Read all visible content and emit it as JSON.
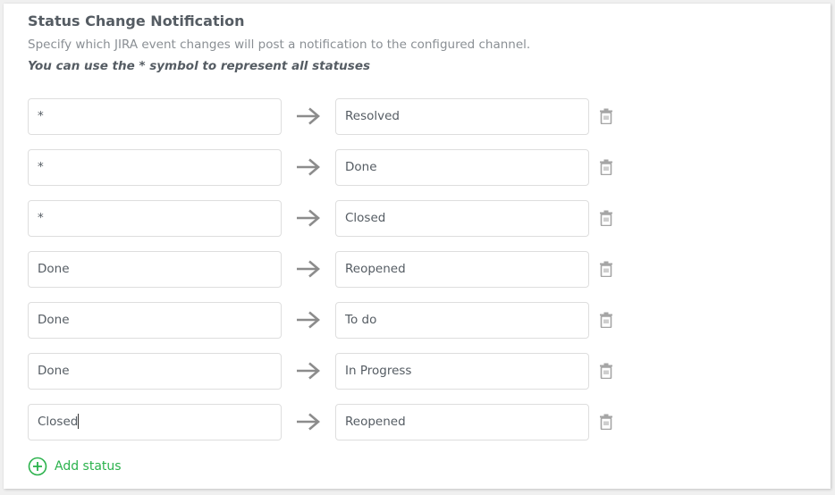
{
  "section": {
    "title": "Status Change Notification",
    "description": "Specify which JIRA event changes will post a notification to the configured channel.",
    "hint": "You can use the * symbol to represent all statuses"
  },
  "rows": [
    {
      "from": "*",
      "to": "Resolved"
    },
    {
      "from": "*",
      "to": "Done"
    },
    {
      "from": "*",
      "to": "Closed"
    },
    {
      "from": "Done",
      "to": "Reopened"
    },
    {
      "from": "Done",
      "to": "To do"
    },
    {
      "from": "Done",
      "to": "In Progress"
    },
    {
      "from": "Closed",
      "to": "Reopened"
    }
  ],
  "add_button": {
    "label": "Add status",
    "icon": "plus-circle-icon"
  },
  "icons": {
    "arrow": "arrow-right-icon",
    "delete": "trash-icon"
  },
  "colors": {
    "accent": "#2bb24c",
    "icon_gray": "#9a9a9a",
    "text": "#555c63",
    "muted": "#8a8f94",
    "border": "#dedede"
  },
  "focused_row_index": 6
}
